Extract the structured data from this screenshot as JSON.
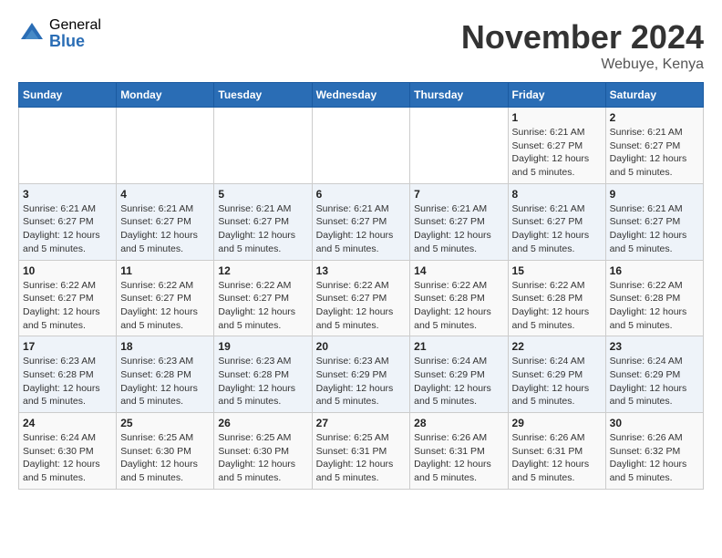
{
  "logo": {
    "general": "General",
    "blue": "Blue"
  },
  "header": {
    "month": "November 2024",
    "location": "Webuye, Kenya"
  },
  "weekdays": [
    "Sunday",
    "Monday",
    "Tuesday",
    "Wednesday",
    "Thursday",
    "Friday",
    "Saturday"
  ],
  "weeks": [
    [
      {
        "day": "",
        "info": ""
      },
      {
        "day": "",
        "info": ""
      },
      {
        "day": "",
        "info": ""
      },
      {
        "day": "",
        "info": ""
      },
      {
        "day": "",
        "info": ""
      },
      {
        "day": "1",
        "info": "Sunrise: 6:21 AM\nSunset: 6:27 PM\nDaylight: 12 hours and 5 minutes."
      },
      {
        "day": "2",
        "info": "Sunrise: 6:21 AM\nSunset: 6:27 PM\nDaylight: 12 hours and 5 minutes."
      }
    ],
    [
      {
        "day": "3",
        "info": "Sunrise: 6:21 AM\nSunset: 6:27 PM\nDaylight: 12 hours and 5 minutes."
      },
      {
        "day": "4",
        "info": "Sunrise: 6:21 AM\nSunset: 6:27 PM\nDaylight: 12 hours and 5 minutes."
      },
      {
        "day": "5",
        "info": "Sunrise: 6:21 AM\nSunset: 6:27 PM\nDaylight: 12 hours and 5 minutes."
      },
      {
        "day": "6",
        "info": "Sunrise: 6:21 AM\nSunset: 6:27 PM\nDaylight: 12 hours and 5 minutes."
      },
      {
        "day": "7",
        "info": "Sunrise: 6:21 AM\nSunset: 6:27 PM\nDaylight: 12 hours and 5 minutes."
      },
      {
        "day": "8",
        "info": "Sunrise: 6:21 AM\nSunset: 6:27 PM\nDaylight: 12 hours and 5 minutes."
      },
      {
        "day": "9",
        "info": "Sunrise: 6:21 AM\nSunset: 6:27 PM\nDaylight: 12 hours and 5 minutes."
      }
    ],
    [
      {
        "day": "10",
        "info": "Sunrise: 6:22 AM\nSunset: 6:27 PM\nDaylight: 12 hours and 5 minutes."
      },
      {
        "day": "11",
        "info": "Sunrise: 6:22 AM\nSunset: 6:27 PM\nDaylight: 12 hours and 5 minutes."
      },
      {
        "day": "12",
        "info": "Sunrise: 6:22 AM\nSunset: 6:27 PM\nDaylight: 12 hours and 5 minutes."
      },
      {
        "day": "13",
        "info": "Sunrise: 6:22 AM\nSunset: 6:27 PM\nDaylight: 12 hours and 5 minutes."
      },
      {
        "day": "14",
        "info": "Sunrise: 6:22 AM\nSunset: 6:28 PM\nDaylight: 12 hours and 5 minutes."
      },
      {
        "day": "15",
        "info": "Sunrise: 6:22 AM\nSunset: 6:28 PM\nDaylight: 12 hours and 5 minutes."
      },
      {
        "day": "16",
        "info": "Sunrise: 6:22 AM\nSunset: 6:28 PM\nDaylight: 12 hours and 5 minutes."
      }
    ],
    [
      {
        "day": "17",
        "info": "Sunrise: 6:23 AM\nSunset: 6:28 PM\nDaylight: 12 hours and 5 minutes."
      },
      {
        "day": "18",
        "info": "Sunrise: 6:23 AM\nSunset: 6:28 PM\nDaylight: 12 hours and 5 minutes."
      },
      {
        "day": "19",
        "info": "Sunrise: 6:23 AM\nSunset: 6:28 PM\nDaylight: 12 hours and 5 minutes."
      },
      {
        "day": "20",
        "info": "Sunrise: 6:23 AM\nSunset: 6:29 PM\nDaylight: 12 hours and 5 minutes."
      },
      {
        "day": "21",
        "info": "Sunrise: 6:24 AM\nSunset: 6:29 PM\nDaylight: 12 hours and 5 minutes."
      },
      {
        "day": "22",
        "info": "Sunrise: 6:24 AM\nSunset: 6:29 PM\nDaylight: 12 hours and 5 minutes."
      },
      {
        "day": "23",
        "info": "Sunrise: 6:24 AM\nSunset: 6:29 PM\nDaylight: 12 hours and 5 minutes."
      }
    ],
    [
      {
        "day": "24",
        "info": "Sunrise: 6:24 AM\nSunset: 6:30 PM\nDaylight: 12 hours and 5 minutes."
      },
      {
        "day": "25",
        "info": "Sunrise: 6:25 AM\nSunset: 6:30 PM\nDaylight: 12 hours and 5 minutes."
      },
      {
        "day": "26",
        "info": "Sunrise: 6:25 AM\nSunset: 6:30 PM\nDaylight: 12 hours and 5 minutes."
      },
      {
        "day": "27",
        "info": "Sunrise: 6:25 AM\nSunset: 6:31 PM\nDaylight: 12 hours and 5 minutes."
      },
      {
        "day": "28",
        "info": "Sunrise: 6:26 AM\nSunset: 6:31 PM\nDaylight: 12 hours and 5 minutes."
      },
      {
        "day": "29",
        "info": "Sunrise: 6:26 AM\nSunset: 6:31 PM\nDaylight: 12 hours and 5 minutes."
      },
      {
        "day": "30",
        "info": "Sunrise: 6:26 AM\nSunset: 6:32 PM\nDaylight: 12 hours and 5 minutes."
      }
    ]
  ]
}
